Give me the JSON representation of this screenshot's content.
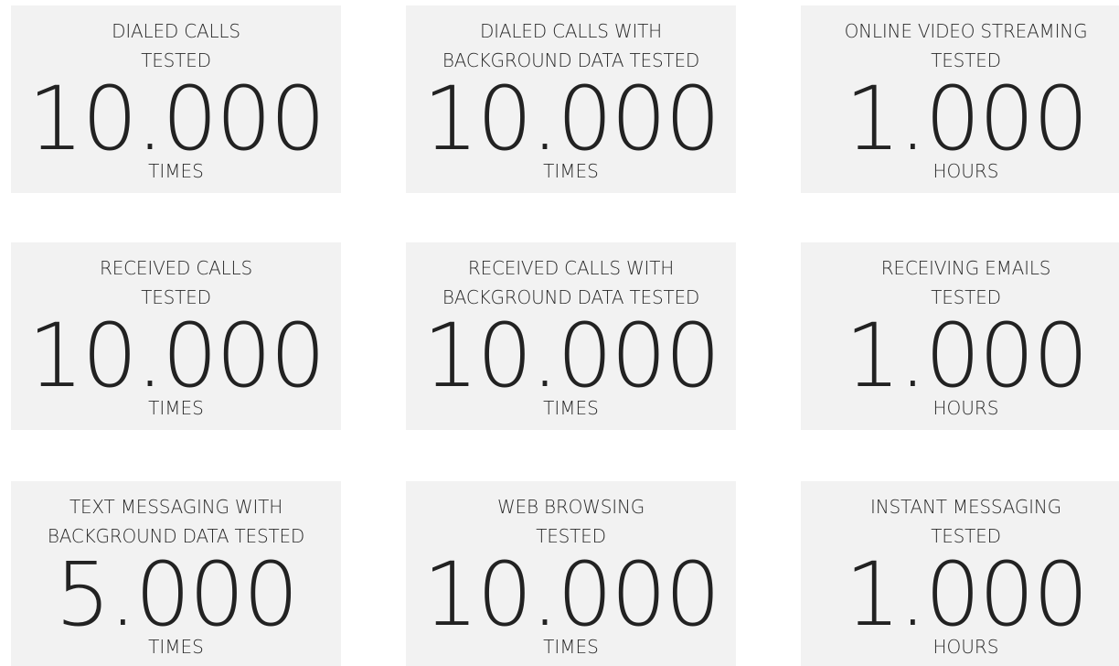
{
  "cards": [
    {
      "line1": "DIALED CALLS",
      "line2": "TESTED",
      "value": "10.000",
      "unit": "TIMES"
    },
    {
      "line1": "DIALED CALLS WITH",
      "line2": "BACKGROUND DATA TESTED",
      "value": "10.000",
      "unit": "TIMES"
    },
    {
      "line1": "ONLINE VIDEO STREAMING",
      "line2": "TESTED",
      "value": "1.000",
      "unit": "HOURS"
    },
    {
      "line1": "RECEIVED CALLS",
      "line2": "TESTED",
      "value": "10.000",
      "unit": "TIMES"
    },
    {
      "line1": "RECEIVED CALLS WITH",
      "line2": "BACKGROUND DATA TESTED",
      "value": "10.000",
      "unit": "TIMES"
    },
    {
      "line1": "RECEIVING EMAILS",
      "line2": "TESTED",
      "value": "1.000",
      "unit": "HOURS"
    },
    {
      "line1": "TEXT MESSAGING WITH",
      "line2": "BACKGROUND DATA TESTED",
      "value": "5.000",
      "unit": "TIMES"
    },
    {
      "line1": "WEB BROWSING",
      "line2": "TESTED",
      "value": "10.000",
      "unit": "TIMES"
    },
    {
      "line1": "INSTANT MESSAGING",
      "line2": "TESTED",
      "value": "1.000",
      "unit": "HOURS"
    }
  ],
  "colors": {
    "card_background": "#f2f2f2",
    "text": "#222222",
    "page_background": "#ffffff"
  }
}
